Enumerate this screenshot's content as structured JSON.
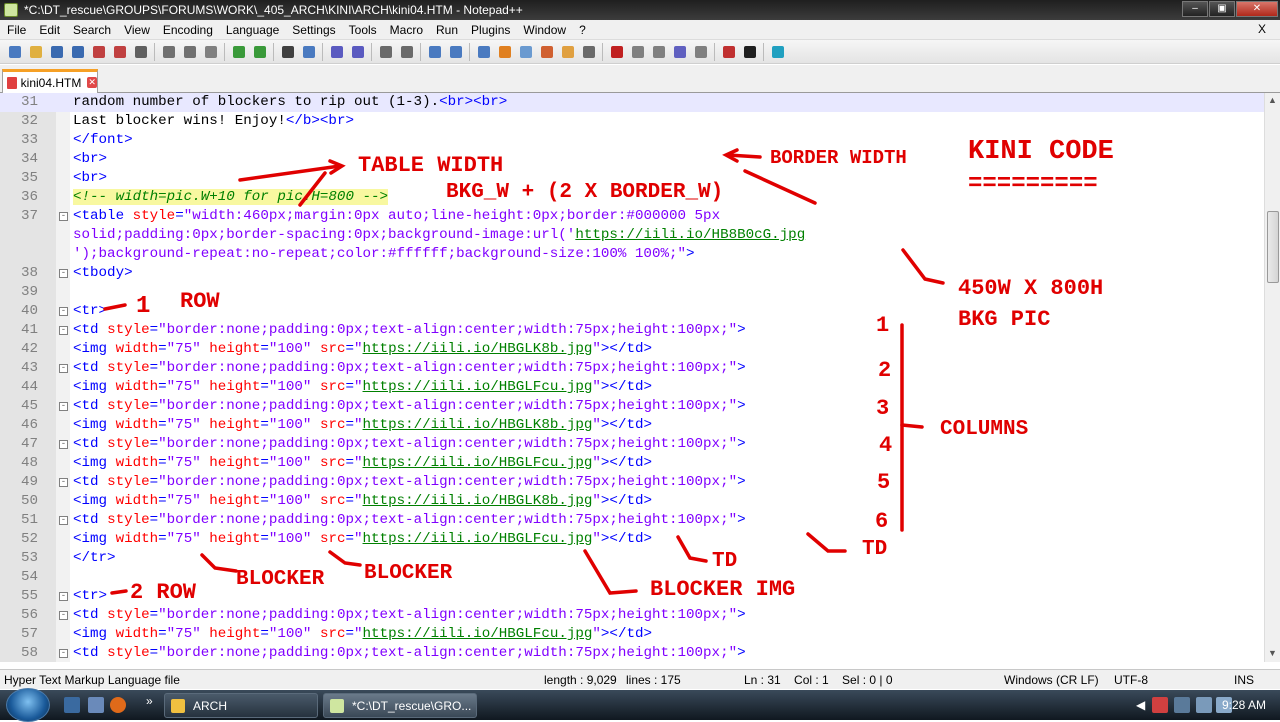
{
  "window": {
    "title": "*C:\\DT_rescue\\GROUPS\\FORUMS\\WORK\\_405_ARCH\\KINI\\ARCH\\kini04.HTM - Notepad++"
  },
  "menu": {
    "items": [
      "File",
      "Edit",
      "Search",
      "View",
      "Encoding",
      "Language",
      "Settings",
      "Tools",
      "Macro",
      "Run",
      "Plugins",
      "Window",
      "?"
    ],
    "close": "X"
  },
  "toolbar": {
    "icons": [
      "new-file-icon",
      "open-file-icon",
      "save-icon",
      "save-all-icon",
      "close-file-icon",
      "close-all-icon",
      "print-icon",
      "cut-icon",
      "copy-icon",
      "paste-icon",
      "undo-icon",
      "redo-icon",
      "find-icon",
      "replace-icon",
      "zoom-in-icon",
      "zoom-out-icon",
      "sync-vertical-icon",
      "sync-horizontal-icon",
      "word-wrap-icon",
      "show-all-chars-icon",
      "indent-guide-icon",
      "user-language-icon",
      "doc-map-icon",
      "function-list-icon",
      "folder-workspace-icon",
      "monitoring-icon",
      "record-macro-icon",
      "stop-record-icon",
      "play-macro-icon",
      "run-macro-multiple-icon",
      "save-macro-icon",
      "spell-check-icon",
      "jslint-icon",
      "plugin-icon"
    ]
  },
  "tab": {
    "label": "kini04.HTM"
  },
  "editor": {
    "lines": [
      {
        "n": "31",
        "fold": "",
        "parts": [
          [
            "t",
            "random number of blockers to rip out (1-3)."
          ],
          [
            "b",
            "<br><br>"
          ]
        ]
      },
      {
        "n": "32",
        "fold": "",
        "parts": [
          [
            "t",
            "Last blocker wins! Enjoy!"
          ],
          [
            "b",
            "</b><br>"
          ]
        ]
      },
      {
        "n": "33",
        "fold": "",
        "parts": [
          [
            "b",
            "</font>"
          ]
        ]
      },
      {
        "n": "34",
        "fold": "",
        "parts": [
          [
            "b",
            "<br>"
          ]
        ]
      },
      {
        "n": "35",
        "fold": "",
        "parts": [
          [
            "b",
            "<br>"
          ]
        ]
      },
      {
        "n": "36",
        "fold": "",
        "parts": [
          [
            "c",
            "<!-- width=pic.W+10 for pic.H=800 -->"
          ]
        ]
      },
      {
        "n": "37",
        "fold": "-",
        "parts": [
          [
            "b",
            "<table "
          ],
          [
            "a",
            "style"
          ],
          [
            "b",
            "="
          ],
          [
            "v",
            "\"width:460px;margin:0px auto;line-height:0px;border:#000000 5px"
          ]
        ]
      },
      {
        "n": "",
        "fold": "",
        "parts": [
          [
            "v",
            "solid;padding:0px;border-spacing:0px;background-image:url('"
          ],
          [
            "u",
            "https://iili.io/HB8B0cG.jpg"
          ]
        ]
      },
      {
        "n": "",
        "fold": "",
        "parts": [
          [
            "v",
            "');background-repeat:no-repeat;color:#ffffff;background-size:100% 100%;\""
          ],
          [
            "b",
            ">"
          ]
        ]
      },
      {
        "n": "38",
        "fold": "-",
        "parts": [
          [
            "b",
            "<tbody>"
          ]
        ]
      },
      {
        "n": "39",
        "fold": "",
        "parts": []
      },
      {
        "n": "40",
        "fold": "-",
        "parts": [
          [
            "b",
            "<tr>"
          ]
        ]
      },
      {
        "n": "41",
        "fold": "-",
        "parts": [
          [
            "b",
            "<td "
          ],
          [
            "a",
            "style"
          ],
          [
            "b",
            "="
          ],
          [
            "v",
            "\"border:none;padding:0px;text-align:center;width:75px;height:100px;\""
          ],
          [
            "b",
            ">"
          ]
        ]
      },
      {
        "n": "42",
        "fold": "",
        "parts": [
          [
            "b",
            "<img "
          ],
          [
            "a",
            "width"
          ],
          [
            "b",
            "="
          ],
          [
            "v",
            "\"75\" "
          ],
          [
            "a",
            "height"
          ],
          [
            "b",
            "="
          ],
          [
            "v",
            "\"100\" "
          ],
          [
            "a",
            "src"
          ],
          [
            "b",
            "="
          ],
          [
            "v",
            "\""
          ],
          [
            "u",
            "https://iili.io/HBGLK8b.jpg"
          ],
          [
            "v",
            "\""
          ],
          [
            "b",
            "></td>"
          ]
        ]
      },
      {
        "n": "43",
        "fold": "-",
        "parts": [
          [
            "b",
            "<td "
          ],
          [
            "a",
            "style"
          ],
          [
            "b",
            "="
          ],
          [
            "v",
            "\"border:none;padding:0px;text-align:center;width:75px;height:100px;\""
          ],
          [
            "b",
            ">"
          ]
        ]
      },
      {
        "n": "44",
        "fold": "",
        "parts": [
          [
            "b",
            "<img "
          ],
          [
            "a",
            "width"
          ],
          [
            "b",
            "="
          ],
          [
            "v",
            "\"75\" "
          ],
          [
            "a",
            "height"
          ],
          [
            "b",
            "="
          ],
          [
            "v",
            "\"100\" "
          ],
          [
            "a",
            "src"
          ],
          [
            "b",
            "="
          ],
          [
            "v",
            "\""
          ],
          [
            "u",
            "https://iili.io/HBGLFcu.jpg"
          ],
          [
            "v",
            "\""
          ],
          [
            "b",
            "></td>"
          ]
        ]
      },
      {
        "n": "45",
        "fold": "-",
        "parts": [
          [
            "b",
            "<td "
          ],
          [
            "a",
            "style"
          ],
          [
            "b",
            "="
          ],
          [
            "v",
            "\"border:none;padding:0px;text-align:center;width:75px;height:100px;\""
          ],
          [
            "b",
            ">"
          ]
        ]
      },
      {
        "n": "46",
        "fold": "",
        "parts": [
          [
            "b",
            "<img "
          ],
          [
            "a",
            "width"
          ],
          [
            "b",
            "="
          ],
          [
            "v",
            "\"75\" "
          ],
          [
            "a",
            "height"
          ],
          [
            "b",
            "="
          ],
          [
            "v",
            "\"100\" "
          ],
          [
            "a",
            "src"
          ],
          [
            "b",
            "="
          ],
          [
            "v",
            "\""
          ],
          [
            "u",
            "https://iili.io/HBGLK8b.jpg"
          ],
          [
            "v",
            "\""
          ],
          [
            "b",
            "></td>"
          ]
        ]
      },
      {
        "n": "47",
        "fold": "-",
        "parts": [
          [
            "b",
            "<td "
          ],
          [
            "a",
            "style"
          ],
          [
            "b",
            "="
          ],
          [
            "v",
            "\"border:none;padding:0px;text-align:center;width:75px;height:100px;\""
          ],
          [
            "b",
            ">"
          ]
        ]
      },
      {
        "n": "48",
        "fold": "",
        "parts": [
          [
            "b",
            "<img "
          ],
          [
            "a",
            "width"
          ],
          [
            "b",
            "="
          ],
          [
            "v",
            "\"75\" "
          ],
          [
            "a",
            "height"
          ],
          [
            "b",
            "="
          ],
          [
            "v",
            "\"100\" "
          ],
          [
            "a",
            "src"
          ],
          [
            "b",
            "="
          ],
          [
            "v",
            "\""
          ],
          [
            "u",
            "https://iili.io/HBGLFcu.jpg"
          ],
          [
            "v",
            "\""
          ],
          [
            "b",
            "></td>"
          ]
        ]
      },
      {
        "n": "49",
        "fold": "-",
        "parts": [
          [
            "b",
            "<td "
          ],
          [
            "a",
            "style"
          ],
          [
            "b",
            "="
          ],
          [
            "v",
            "\"border:none;padding:0px;text-align:center;width:75px;height:100px;\""
          ],
          [
            "b",
            ">"
          ]
        ]
      },
      {
        "n": "50",
        "fold": "",
        "parts": [
          [
            "b",
            "<img "
          ],
          [
            "a",
            "width"
          ],
          [
            "b",
            "="
          ],
          [
            "v",
            "\"75\" "
          ],
          [
            "a",
            "height"
          ],
          [
            "b",
            "="
          ],
          [
            "v",
            "\"100\" "
          ],
          [
            "a",
            "src"
          ],
          [
            "b",
            "="
          ],
          [
            "v",
            "\""
          ],
          [
            "u",
            "https://iili.io/HBGLK8b.jpg"
          ],
          [
            "v",
            "\""
          ],
          [
            "b",
            "></td>"
          ]
        ]
      },
      {
        "n": "51",
        "fold": "-",
        "parts": [
          [
            "b",
            "<td "
          ],
          [
            "a",
            "style"
          ],
          [
            "b",
            "="
          ],
          [
            "v",
            "\"border:none;padding:0px;text-align:center;width:75px;height:100px;\""
          ],
          [
            "b",
            ">"
          ]
        ]
      },
      {
        "n": "52",
        "fold": "",
        "parts": [
          [
            "b",
            "<img "
          ],
          [
            "a",
            "width"
          ],
          [
            "b",
            "="
          ],
          [
            "v",
            "\"75\" "
          ],
          [
            "a",
            "height"
          ],
          [
            "b",
            "="
          ],
          [
            "v",
            "\"100\" "
          ],
          [
            "a",
            "src"
          ],
          [
            "b",
            "="
          ],
          [
            "v",
            "\""
          ],
          [
            "u",
            "https://iili.io/HBGLFcu.jpg"
          ],
          [
            "v",
            "\""
          ],
          [
            "b",
            "></td>"
          ]
        ]
      },
      {
        "n": "53",
        "fold": "",
        "parts": [
          [
            "b",
            "</tr>"
          ]
        ]
      },
      {
        "n": "54",
        "fold": "",
        "parts": []
      },
      {
        "n": "55",
        "fold": "-",
        "parts": [
          [
            "b",
            "<tr>"
          ]
        ]
      },
      {
        "n": "56",
        "fold": "-",
        "parts": [
          [
            "b",
            "<td "
          ],
          [
            "a",
            "style"
          ],
          [
            "b",
            "="
          ],
          [
            "v",
            "\"border:none;padding:0px;text-align:center;width:75px;height:100px;\""
          ],
          [
            "b",
            ">"
          ]
        ]
      },
      {
        "n": "57",
        "fold": "",
        "parts": [
          [
            "b",
            "<img "
          ],
          [
            "a",
            "width"
          ],
          [
            "b",
            "="
          ],
          [
            "v",
            "\"75\" "
          ],
          [
            "a",
            "height"
          ],
          [
            "b",
            "="
          ],
          [
            "v",
            "\"100\" "
          ],
          [
            "a",
            "src"
          ],
          [
            "b",
            "="
          ],
          [
            "v",
            "\""
          ],
          [
            "u",
            "https://iili.io/HBGLFcu.jpg"
          ],
          [
            "v",
            "\""
          ],
          [
            "b",
            "></td>"
          ]
        ]
      },
      {
        "n": "58",
        "fold": "-",
        "parts": [
          [
            "b",
            "<td "
          ],
          [
            "a",
            "style"
          ],
          [
            "b",
            "="
          ],
          [
            "v",
            "\"border:none;padding:0px;text-align:center;width:75px;height:100px;\""
          ],
          [
            "b",
            ">"
          ]
        ]
      }
    ]
  },
  "annotations": {
    "table_width": "TABLE WIDTH",
    "border_width": "BORDER WIDTH",
    "kini_code": "KINI CODE",
    "underline": "=========",
    "bkg_formula": "BKG_W + (2 X BORDER_W)",
    "bkg_size": "450W X 800H",
    "bkg_pic": "BKG PIC",
    "row1_num": "1",
    "row1_word": "ROW",
    "row2": "2 ROW",
    "columns": "COLUMNS",
    "col_numbers": [
      "1",
      "2",
      "3",
      "4",
      "5",
      "6"
    ],
    "blocker1": "BLOCKER",
    "blocker2": "BLOCKER",
    "blocker_img": "BLOCKER IMG",
    "td1": "TD",
    "td2": "TD",
    "color": "#e00000"
  },
  "status": {
    "filetype": "Hyper Text Markup Language file",
    "length": "length : 9,029",
    "lines": "lines : 175",
    "position": "Ln : 31    Col : 1    Sel : 0 | 0",
    "eol": "Windows (CR LF)",
    "encoding": "UTF-8",
    "mode": "INS"
  },
  "taskbar": {
    "buttons": [
      "ARCH",
      "*C:\\DT_rescue\\GRO..."
    ],
    "clock": "9:28 AM",
    "overflow": "»"
  }
}
